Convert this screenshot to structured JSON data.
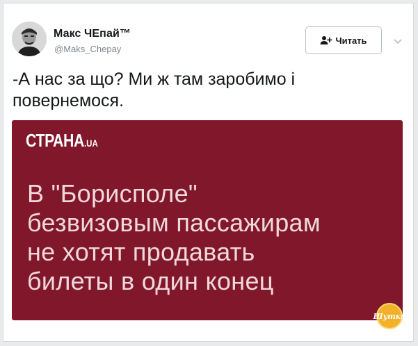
{
  "tweet": {
    "author_name": "Макс ЧЕпай™",
    "author_handle": "@Maks_Chepay",
    "follow_label": "Читать",
    "text_line1": "-А нас за що? Ми ж там заробимо і",
    "text_line2": "повернемося."
  },
  "media": {
    "brand": "СТРАНА",
    "brand_suffix": ".UA",
    "headline_lines": [
      "В \"Борисполе\"",
      "безвизовым пассажирам",
      "не хотят продавать",
      "билеты в один конец"
    ],
    "background_color": "#81172a"
  },
  "watermark": {
    "text": "Шутка"
  },
  "icons": {
    "follow": "add-user-icon",
    "menu": "chevron-down-icon"
  }
}
